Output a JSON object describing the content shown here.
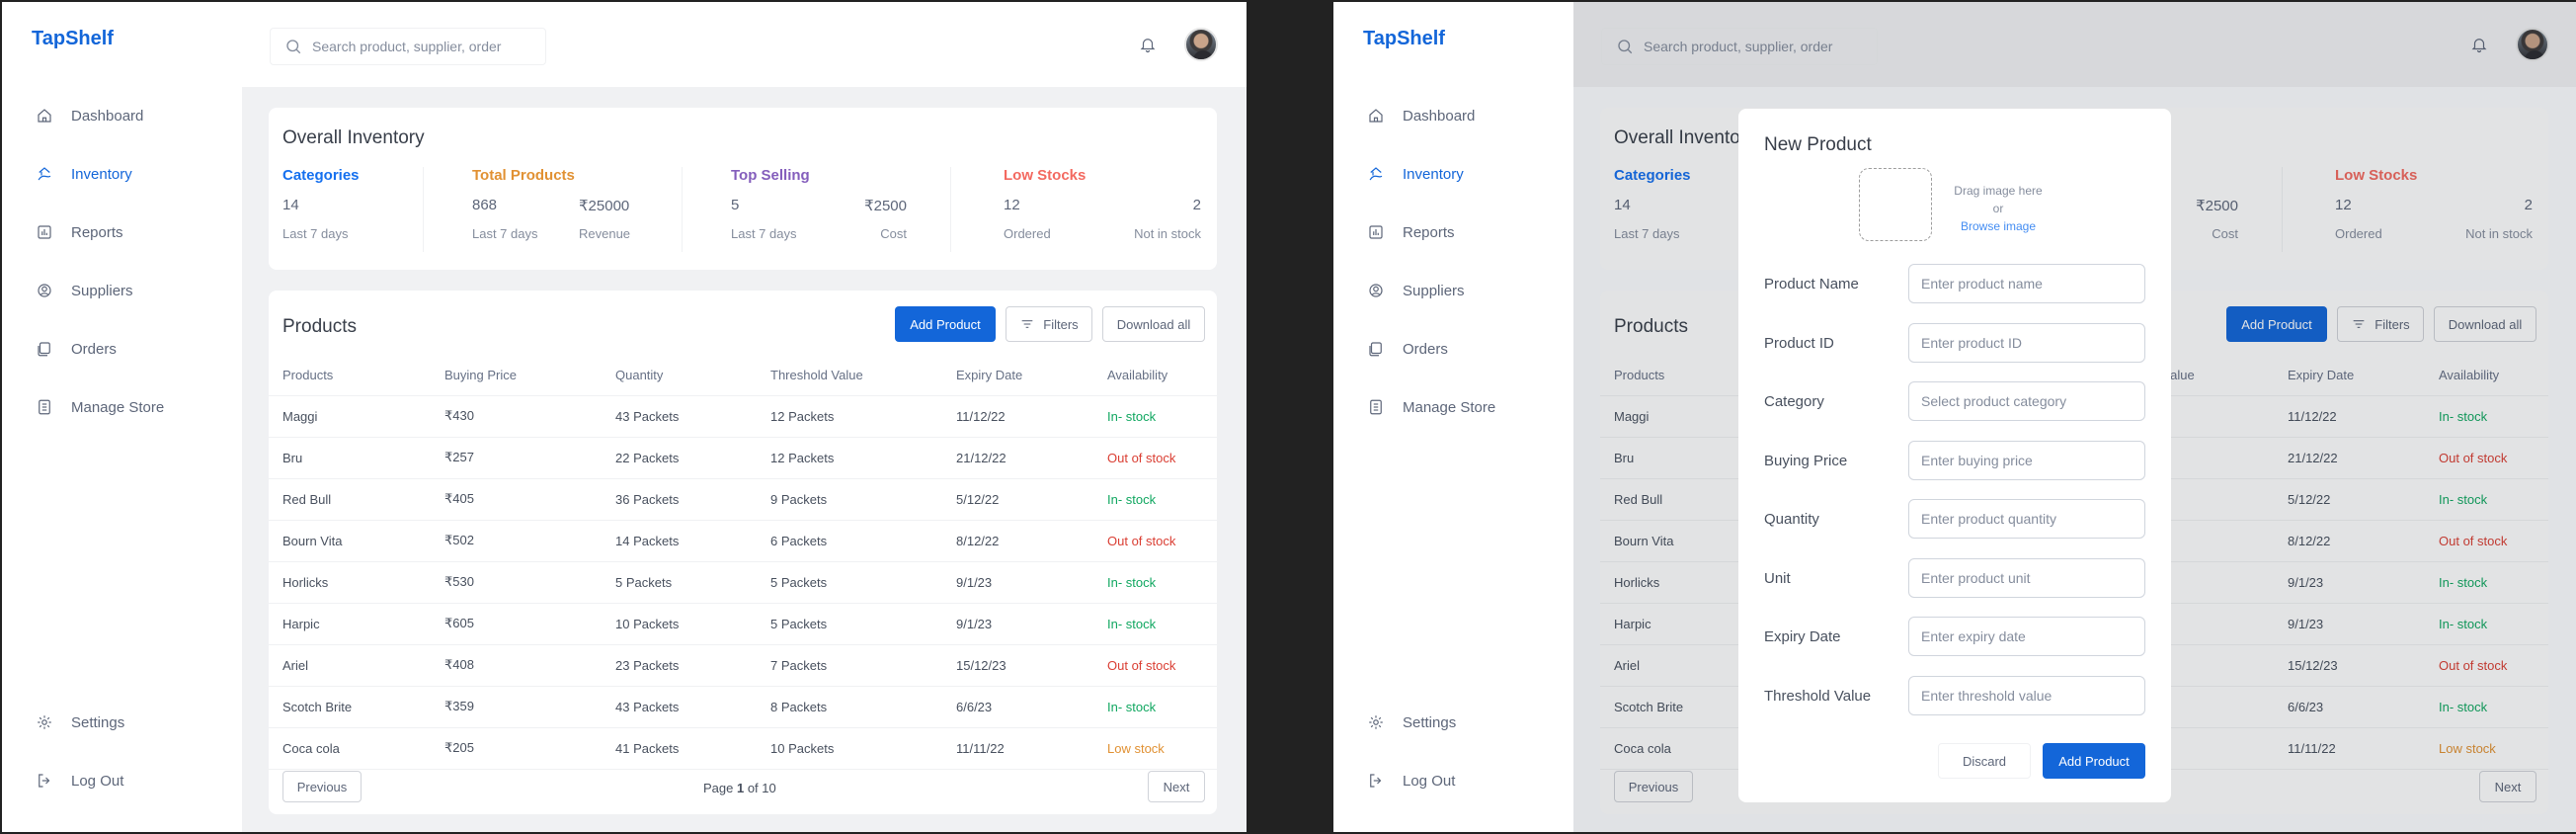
{
  "app": {
    "logo": "TapShelf",
    "nav": [
      {
        "label": "Dashboard",
        "icon": "home-icon"
      },
      {
        "label": "Inventory",
        "icon": "inventory-icon"
      },
      {
        "label": "Reports",
        "icon": "reports-icon"
      },
      {
        "label": "Suppliers",
        "icon": "suppliers-icon"
      },
      {
        "label": "Orders",
        "icon": "orders-icon"
      },
      {
        "label": "Manage Store",
        "icon": "store-icon"
      }
    ],
    "bottom_nav": [
      {
        "label": "Settings",
        "icon": "gear-icon"
      },
      {
        "label": "Log Out",
        "icon": "logout-icon"
      }
    ],
    "active_nav": "Inventory",
    "accent_color": "#1366D9",
    "search_placeholder": "Search product, supplier, order"
  },
  "overview": {
    "title": "Overall Inventory",
    "categories": {
      "title": "Categories",
      "value": "14",
      "label": "Last 7 days",
      "color": "#1570EF"
    },
    "total_products": {
      "title": "Total Products",
      "value": "868",
      "label": "Last 7 days",
      "value2": "₹25000",
      "label2": "Revenue",
      "color": "#E19133"
    },
    "top_selling": {
      "title": "Top Selling",
      "value": "5",
      "label": "Last 7 days",
      "value2": "₹2500",
      "label2": "Cost",
      "color": "#845EBC"
    },
    "low_stocks": {
      "title": "Low Stocks",
      "value": "12",
      "label": "Ordered",
      "value2": "2",
      "label2": "Not in stock",
      "color": "#F36960"
    }
  },
  "products": {
    "title": "Products",
    "add_label": "Add Product",
    "filters_label": "Filters",
    "download_label": "Download all",
    "columns": [
      "Products",
      "Buying Price",
      "Quantity",
      "Threshold Value",
      "Expiry Date",
      "Availability"
    ],
    "rows": [
      {
        "name": "Maggi",
        "price": "₹430",
        "qty": "43 Packets",
        "threshold": "12 Packets",
        "expiry": "11/12/22",
        "availability": "In- stock",
        "status": "in"
      },
      {
        "name": "Bru",
        "price": "₹257",
        "qty": "22 Packets",
        "threshold": "12 Packets",
        "expiry": "21/12/22",
        "availability": "Out of stock",
        "status": "out"
      },
      {
        "name": "Red Bull",
        "price": "₹405",
        "qty": "36 Packets",
        "threshold": "9 Packets",
        "expiry": "5/12/22",
        "availability": "In- stock",
        "status": "in"
      },
      {
        "name": "Bourn Vita",
        "price": "₹502",
        "qty": "14 Packets",
        "threshold": "6 Packets",
        "expiry": "8/12/22",
        "availability": "Out of stock",
        "status": "out"
      },
      {
        "name": "Horlicks",
        "price": "₹530",
        "qty": "5 Packets",
        "threshold": "5 Packets",
        "expiry": "9/1/23",
        "availability": "In- stock",
        "status": "in"
      },
      {
        "name": "Harpic",
        "price": "₹605",
        "qty": "10 Packets",
        "threshold": "5 Packets",
        "expiry": "9/1/23",
        "availability": "In- stock",
        "status": "in"
      },
      {
        "name": "Ariel",
        "price": "₹408",
        "qty": "23 Packets",
        "threshold": "7 Packets",
        "expiry": "15/12/23",
        "availability": "Out of stock",
        "status": "out"
      },
      {
        "name": "Scotch Brite",
        "price": "₹359",
        "qty": "43 Packets",
        "threshold": "8 Packets",
        "expiry": "6/6/23",
        "availability": "In- stock",
        "status": "in"
      },
      {
        "name": "Coca cola",
        "price": "₹205",
        "qty": "41 Packets",
        "threshold": "10 Packets",
        "expiry": "11/11/22",
        "availability": "Low  stock",
        "status": "low"
      }
    ],
    "prev_label": "Previous",
    "next_label": "Next",
    "page_prefix": "Page ",
    "page_current": "1",
    "page_suffix": " of 10"
  },
  "modal": {
    "title": "New Product",
    "drag_text": "Drag image here",
    "or_text": "or",
    "browse_text": "Browse image",
    "fields": [
      {
        "label": "Product Name",
        "placeholder": "Enter product name"
      },
      {
        "label": "Product ID",
        "placeholder": "Enter product ID"
      },
      {
        "label": "Category",
        "placeholder": "Select product category"
      },
      {
        "label": "Buying Price",
        "placeholder": "Enter buying price"
      },
      {
        "label": "Quantity",
        "placeholder": "Enter product quantity"
      },
      {
        "label": "Unit",
        "placeholder": "Enter product unit"
      },
      {
        "label": "Expiry Date",
        "placeholder": "Enter expiry date"
      },
      {
        "label": "Threshold Value",
        "placeholder": "Enter threshold value"
      }
    ],
    "discard_label": "Discard",
    "submit_label": "Add Product"
  }
}
